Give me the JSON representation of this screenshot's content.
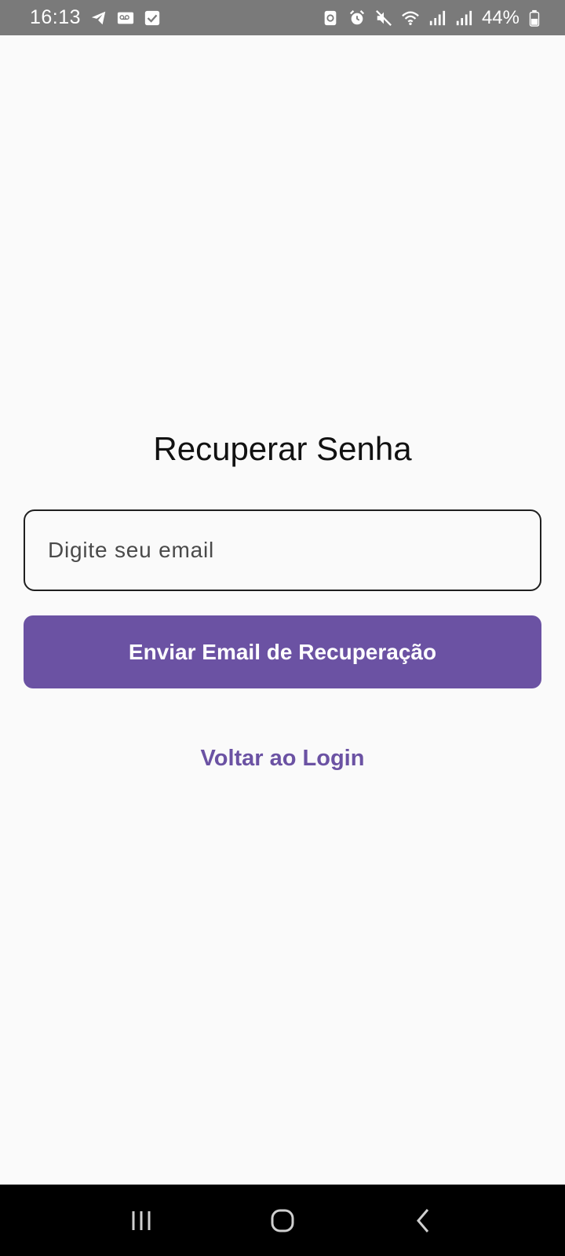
{
  "status_bar": {
    "time": "16:13",
    "battery_percent": "44%",
    "left_icons": [
      "telegram-icon",
      "voicemail-icon",
      "checkbox-icon"
    ],
    "right_icons": [
      "data-saver-icon",
      "alarm-icon",
      "mute-icon",
      "wifi-icon",
      "signal-icon",
      "signal-icon",
      "battery-icon"
    ],
    "background": "#7a7a7a"
  },
  "main": {
    "title": "Recuperar Senha",
    "email_input": {
      "placeholder": "Digite seu email",
      "value": ""
    },
    "submit_label": "Enviar Email de Recuperação",
    "back_link_label": "Voltar ao Login"
  },
  "nav_bar": {
    "buttons": [
      "recents-icon",
      "home-icon",
      "back-icon"
    ]
  },
  "colors": {
    "accent": "#6b52a3",
    "background": "#fafafa",
    "text": "#111111"
  }
}
